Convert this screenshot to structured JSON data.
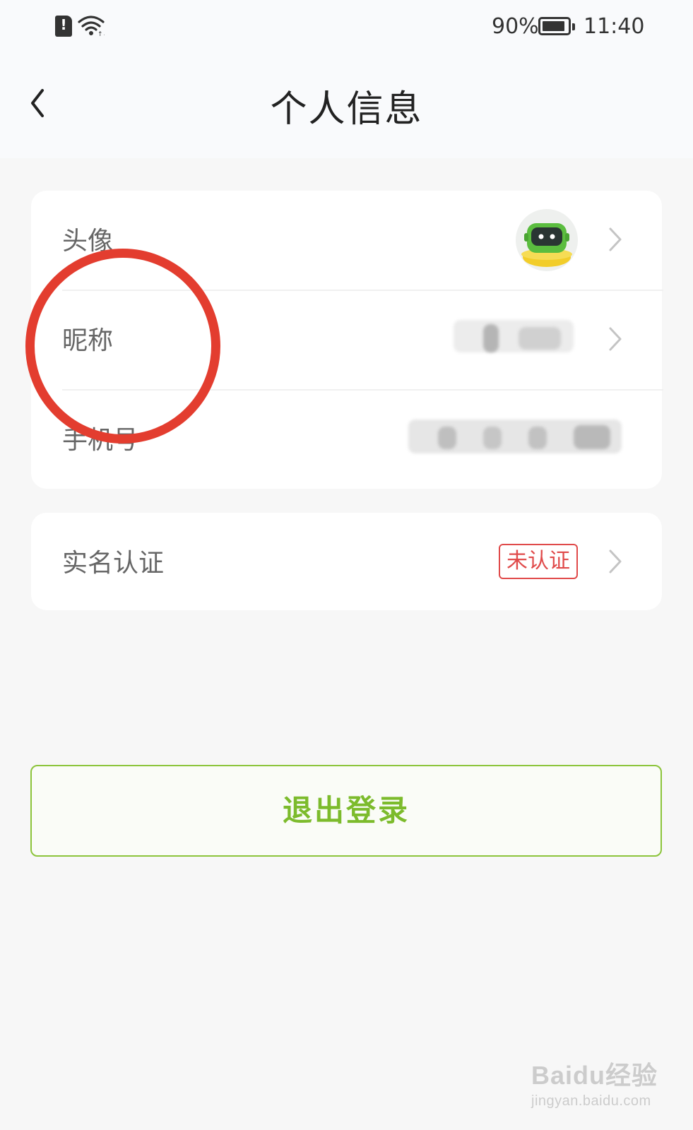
{
  "status_bar": {
    "battery": "90%",
    "time": "11:40",
    "battery_level": 0.9,
    "icons": [
      "sim-alert-icon",
      "wifi-icon",
      "battery-icon"
    ]
  },
  "header": {
    "title": "个人信息",
    "back_icon": "chevron-left-icon"
  },
  "profile_card": {
    "avatar_label": "头像",
    "nickname_label": "昵称",
    "phone_label": "手机号"
  },
  "realname_card": {
    "label": "实名认证",
    "status_badge": "未认证"
  },
  "logout_label": "退出登录",
  "watermark": {
    "main": "Baidu经验",
    "sub": "jingyan.baidu.com"
  },
  "colors": {
    "accent_green": "#7cbb2c",
    "badge_red": "#e04a4a",
    "annotation_red": "#e33d2f"
  }
}
